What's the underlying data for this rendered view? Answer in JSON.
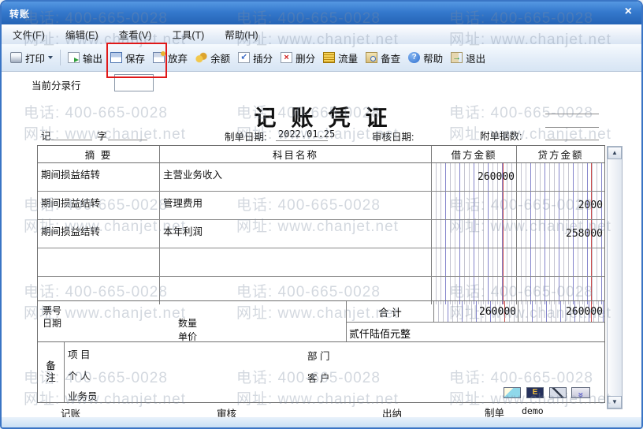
{
  "window": {
    "title": "转账"
  },
  "menu": {
    "items": [
      "文件(F)",
      "编辑(E)",
      "查看(V)",
      "工具(T)",
      "帮助(H)"
    ]
  },
  "toolbar": {
    "buttons": [
      {
        "label": "打印"
      },
      {
        "label": "输出"
      },
      {
        "label": "保存"
      },
      {
        "label": "放弃"
      },
      {
        "label": "余额"
      },
      {
        "label": "插分"
      },
      {
        "label": "删分"
      },
      {
        "label": "流量"
      },
      {
        "label": "备查"
      },
      {
        "label": "帮助"
      },
      {
        "label": "退出"
      }
    ]
  },
  "entry_row": {
    "label": "当前分录行",
    "value": ""
  },
  "watermark": {
    "phone": "电话: 400-665-0028",
    "web": "网址: www.chanjet.net"
  },
  "icons": {
    "close": "×",
    "scroll_up": "▲",
    "scroll_down": "▼",
    "help_glyph": "?",
    "delete_glyph": "×",
    "insert_glyph": "↙",
    "exit_glyph": "→",
    "collapse_glyph": "»",
    "cash_letter": "E"
  },
  "colors": {
    "titlebar": "#3579cd",
    "highlight": "#e01818",
    "ruled_blue": "#5a5ac8",
    "ruled_red": "#cc4a4a"
  },
  "voucher": {
    "title": "记 账 凭 证",
    "word_prefix": "记",
    "word_suffix": "字",
    "made_date_label": "制单日期:",
    "made_date": "2022.01.25",
    "audit_date_label": "审核日期:",
    "attach_label": "附单据数:",
    "table": {
      "headers": {
        "summary": "摘 要",
        "account": "科目名称",
        "debit": "借方金额",
        "credit": "贷方金额"
      },
      "rows": [
        {
          "summary": "期间损益结转",
          "account": "主营业务收入",
          "debit": "260000",
          "credit": ""
        },
        {
          "summary": "期间损益结转",
          "account": "管理费用",
          "debit": "",
          "credit": "2000"
        },
        {
          "summary": "期间损益结转",
          "account": "本年利润",
          "debit": "",
          "credit": "258000"
        },
        {
          "summary": "",
          "account": "",
          "debit": "",
          "credit": ""
        },
        {
          "summary": "",
          "account": "",
          "debit": "",
          "credit": ""
        }
      ]
    },
    "total": {
      "label": "合  计",
      "debit": "260000",
      "credit": "260000",
      "in_words": "贰仟陆佰元整"
    },
    "bottom_left": {
      "ticket": "票号",
      "date": "日期",
      "qty": "数量",
      "price": "单价"
    },
    "note": {
      "label": "备注",
      "item": "项  目",
      "dept": "部  门",
      "person": "个  人",
      "customer": "客  户",
      "salesman": "业务员"
    },
    "signatures": {
      "bookkeeping": "记账",
      "audit": "审核",
      "cashier": "出纳",
      "made_by": "制单",
      "maker": "demo"
    }
  }
}
